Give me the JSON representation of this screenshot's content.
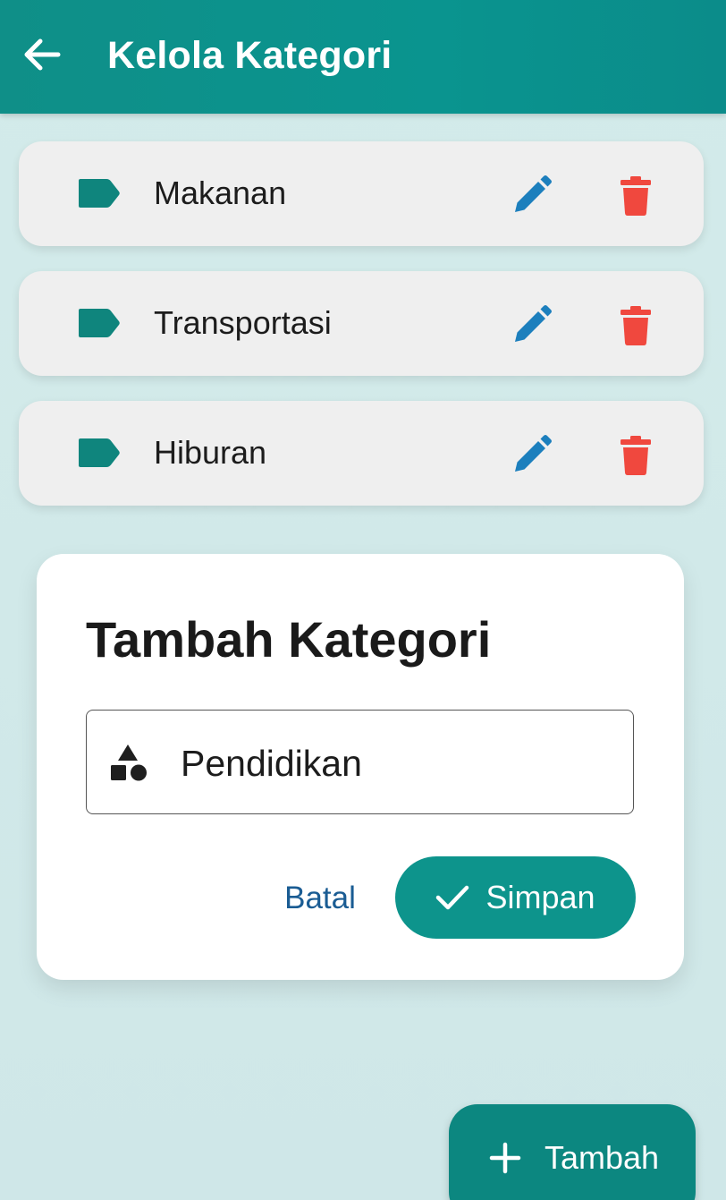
{
  "app_bar": {
    "title": "Kelola Kategori",
    "back_icon": "arrow-left-icon"
  },
  "categories": [
    {
      "label": "Makanan",
      "icon": "label-tag-icon",
      "edit_icon": "pencil-icon",
      "delete_icon": "trash-icon"
    },
    {
      "label": "Transportasi",
      "icon": "label-tag-icon",
      "edit_icon": "pencil-icon",
      "delete_icon": "trash-icon"
    },
    {
      "label": "Hiburan",
      "icon": "label-tag-icon",
      "edit_icon": "pencil-icon",
      "delete_icon": "trash-icon"
    }
  ],
  "dialog": {
    "title": "Tambah Kategori",
    "field": {
      "icon": "shapes-icon",
      "value": "Pendidikan"
    },
    "cancel_label": "Batal",
    "save_label": "Simpan",
    "save_icon": "check-icon"
  },
  "fab": {
    "label": "Tambah",
    "icon": "plus-icon"
  },
  "colors": {
    "primary": "#0d948c",
    "tag": "#0f857d",
    "edit": "#1c7fbd",
    "delete": "#f0483e",
    "cancel_text": "#1a5c93",
    "background": "#d3ebea"
  }
}
